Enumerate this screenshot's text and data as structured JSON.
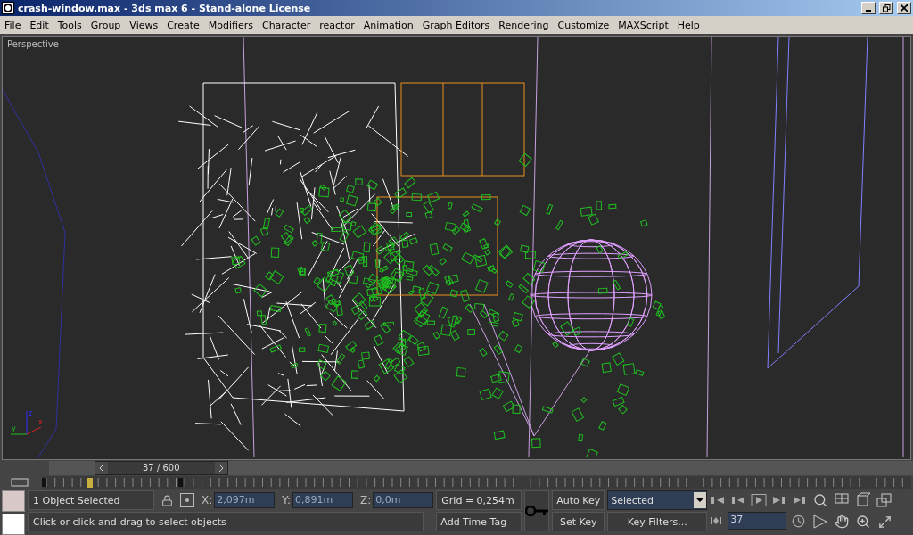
{
  "window": {
    "title": "crash-window.max - 3ds max 6 - Stand-alone License"
  },
  "menu": [
    "File",
    "Edit",
    "Tools",
    "Group",
    "Views",
    "Create",
    "Modifiers",
    "Character",
    "reactor",
    "Animation",
    "Graph Editors",
    "Rendering",
    "Customize",
    "MAXScript",
    "Help"
  ],
  "viewport": {
    "label": "Perspective",
    "axis_labels": [
      "z",
      "y",
      "x"
    ]
  },
  "time_slider": {
    "reading": "37 / 600",
    "level": 0.062
  },
  "status": {
    "selection": "1 Object Selected",
    "coords": [
      {
        "axis": "X:",
        "value": "2,097m"
      },
      {
        "axis": "Y:",
        "value": "0,891m"
      },
      {
        "axis": "Z:",
        "value": "0,0m"
      }
    ],
    "grid": "Grid = 0,254m",
    "add_time_tag": "Add Time Tag",
    "prompt": "Click or click-and-drag to select objects"
  },
  "keys": {
    "auto_key": "Auto Key",
    "set_key": "Set Key",
    "key_mode": "Selected",
    "key_filters": "Key Filters...",
    "frame": "37"
  }
}
